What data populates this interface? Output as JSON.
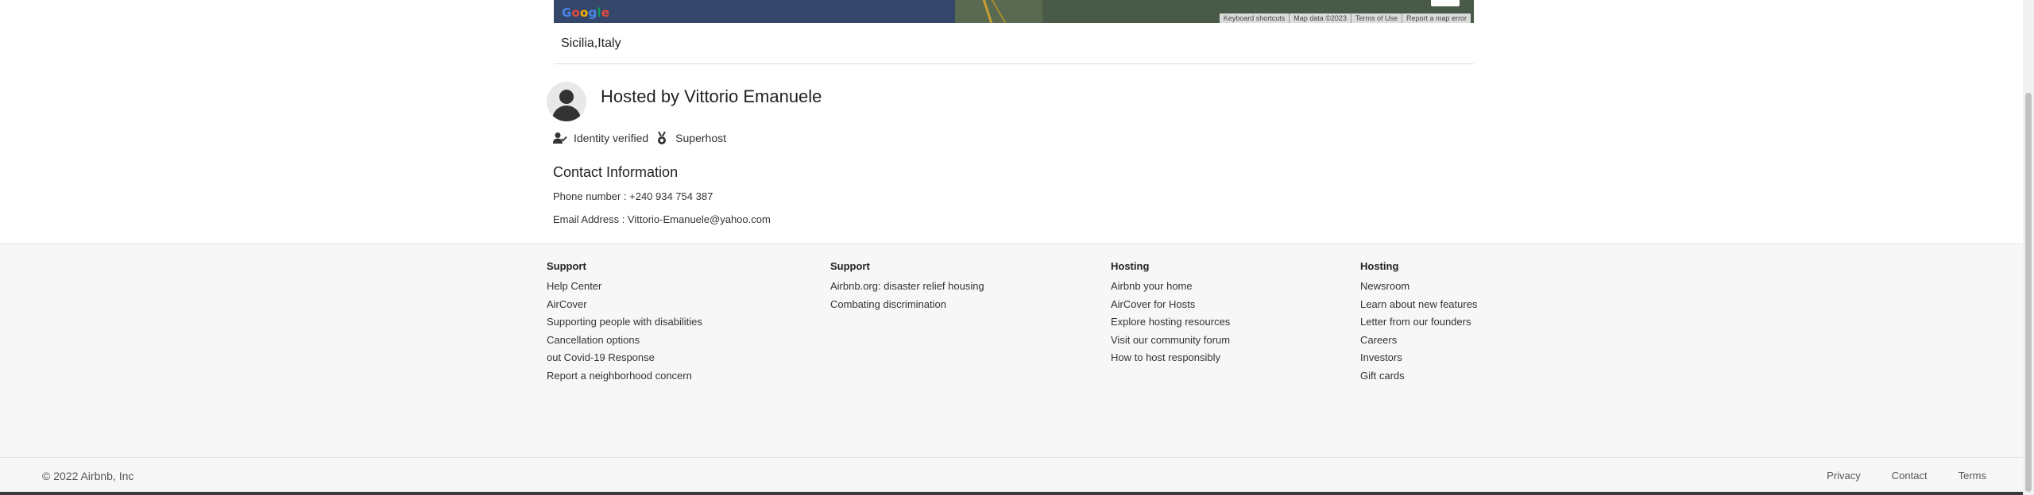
{
  "map": {
    "logo": "Google",
    "attribution": [
      "Keyboard shortcuts",
      "Map data ©2023",
      "Terms of Use",
      "Report a map error"
    ]
  },
  "listing": {
    "location": "Sicilia,Italy"
  },
  "host": {
    "title": "Hosted by Vittorio Emanuele",
    "badges": [
      {
        "label": "Identity verified",
        "icon": "person-check-icon"
      },
      {
        "label": "Superhost",
        "icon": "medal-icon"
      }
    ]
  },
  "contact": {
    "title": "Contact Information",
    "phone": "Phone number : +240 934 754 387",
    "email": "Email Address : Vittorio-Emanuele@yahoo.com"
  },
  "footer": {
    "columns": [
      {
        "heading": "Support",
        "links": [
          "Help Center",
          "AirCover",
          "Supporting people with disabilities",
          "Cancellation options",
          "out Covid-19 Response",
          "Report a neighborhood concern"
        ]
      },
      {
        "heading": "Support",
        "links": [
          "Airbnb.org: disaster relief housing",
          "Combating discrimination"
        ]
      },
      {
        "heading": "Hosting",
        "links": [
          "Airbnb your home",
          "AirCover for Hosts",
          "Explore hosting resources",
          "Visit our community forum",
          "How to host responsibly"
        ]
      },
      {
        "heading": "Hosting",
        "links": [
          "Newsroom",
          "Learn about new features",
          "Letter from our founders",
          "Careers",
          "Investors",
          "Gift cards"
        ]
      }
    ],
    "copyright": "© 2022 Airbnb, Inc",
    "bottom_links": [
      "Privacy",
      "Contact",
      "Terms"
    ]
  }
}
